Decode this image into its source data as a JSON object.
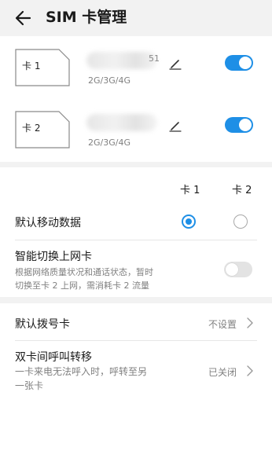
{
  "header": {
    "title": "SIM 卡管理"
  },
  "sims": [
    {
      "label": "卡 1",
      "number_suffix": "51",
      "network": "2G/3G/4G",
      "enabled": true
    },
    {
      "label": "卡 2",
      "network": "2G/3G/4G",
      "enabled": true
    }
  ],
  "data_settings": {
    "col_card1": "卡 1",
    "col_card2": "卡 2",
    "default_data": {
      "label": "默认移动数据",
      "selected": "卡 1"
    },
    "smart_switch": {
      "label": "智能切换上网卡",
      "desc_line1": "根据网络质量状况和通话状态，暂时",
      "desc_line2": "切换至卡 2 上网，需消耗卡 2 流量",
      "enabled": false
    }
  },
  "call_settings": {
    "default_dial": {
      "label": "默认拨号卡",
      "value": "不设置"
    },
    "call_forward": {
      "label": "双卡间呼叫转移",
      "desc_line1": "一卡来电无法呼入时，呼转至另",
      "desc_line2": "一张卡",
      "value": "已关闭"
    }
  },
  "colors": {
    "accent": "#1e8fe6",
    "background": "#f2f2f2"
  }
}
